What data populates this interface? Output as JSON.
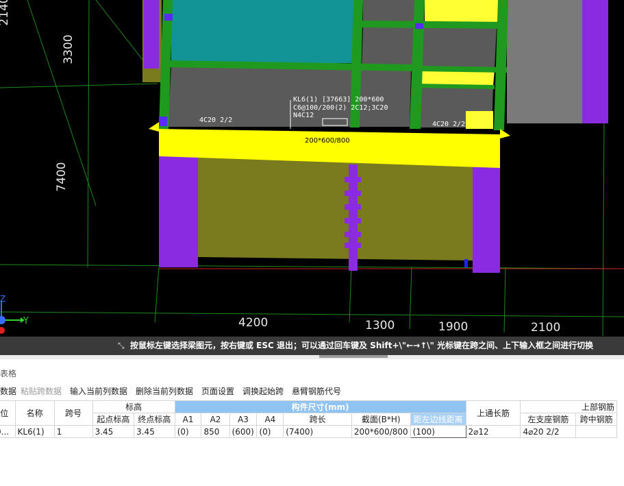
{
  "viewport": {
    "beam_label_lines": [
      "KL6(1) [37663] 200*600",
      "C6@100/200(2) 2C12;3C20",
      "N4C12"
    ],
    "left_support_label": "4C20 2/2",
    "right_support_label": "4C20 2/2",
    "beam_section_label": "200*600/800",
    "dims_bottom": [
      "4200",
      "1300",
      "1900",
      "2100"
    ],
    "dims_left": [
      "2140",
      "3300",
      "7400"
    ],
    "axis_label_y": "Y",
    "axis_label_z": "Z"
  },
  "status_bar": {
    "message": "按鼠标左键选择梁图元，按右键或 ESC 退出；可以通过回车键及 Shift+\\\"←→↑\\\" 光标键在跨之间、上下输入框之间进行切换"
  },
  "panel": {
    "title": "表格",
    "toolbar": [
      {
        "label": "数据",
        "enabled": true
      },
      {
        "label": "粘贴跨数据",
        "enabled": false
      },
      {
        "label": "输入当前列数据",
        "enabled": true
      },
      {
        "label": "删除当前列数据",
        "enabled": true
      },
      {
        "label": "页面设置",
        "enabled": true
      },
      {
        "label": "调换起始跨",
        "enabled": true
      },
      {
        "label": "悬臂钢筋代号",
        "enabled": true
      }
    ],
    "table": {
      "group_elev": "标高",
      "group_size": "构件尺寸(mm)",
      "group_top": "上部钢筋",
      "h_col0": "位",
      "h_name": "名称",
      "h_span": "跨号",
      "h_start_elev": "起点标高",
      "h_end_elev": "终点标高",
      "h_a1": "A1",
      "h_a2": "A2",
      "h_a3": "A3",
      "h_a4": "A4",
      "h_span_len": "跨长",
      "h_section": "截面(B*H)",
      "h_offset": "距左边线距离",
      "h_top_long": "上通长筋",
      "h_left_support": "左支座钢筋",
      "h_mid_span": "跨中钢筋",
      "row": {
        "col0": "0...",
        "name": "KL6(1)",
        "span": "1",
        "start_elev": "3.45",
        "end_elev": "3.45",
        "a1": "(0)",
        "a2": "850",
        "a3": "(600)",
        "a4": "(0)",
        "span_len": "(7400)",
        "section": "200*600/800",
        "offset": "(100)",
        "top_long": "2⌀12",
        "left_support": "4⌀20 2/2",
        "mid_span": ""
      }
    }
  }
}
